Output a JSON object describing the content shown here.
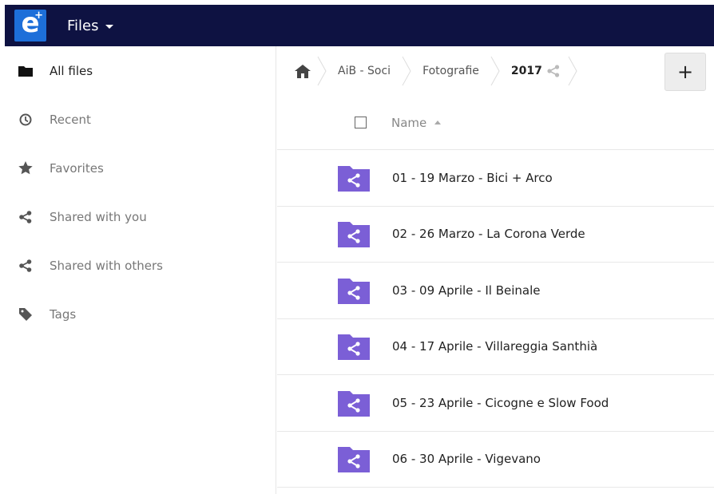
{
  "header": {
    "app_name": "Files"
  },
  "sidebar": {
    "items": [
      {
        "label": "All files",
        "icon": "folder-icon",
        "active": true
      },
      {
        "label": "Recent",
        "icon": "clock-icon",
        "active": false
      },
      {
        "label": "Favorites",
        "icon": "star-icon",
        "active": false
      },
      {
        "label": "Shared with you",
        "icon": "share-icon",
        "active": false
      },
      {
        "label": "Shared with others",
        "icon": "share-icon",
        "active": false
      },
      {
        "label": "Tags",
        "icon": "tag-icon",
        "active": false
      }
    ]
  },
  "breadcrumb": {
    "home_icon": "home-icon",
    "items": [
      "AiB - Soci",
      "Fotografie",
      "2017"
    ]
  },
  "file_list": {
    "column_name": "Name",
    "rows": [
      {
        "name": "01 - 19 Marzo - Bici + Arco",
        "icon": "shared-folder-icon"
      },
      {
        "name": "02 - 26 Marzo - La Corona Verde",
        "icon": "shared-folder-icon"
      },
      {
        "name": "03 - 09 Aprile - Il Beinale",
        "icon": "shared-folder-icon"
      },
      {
        "name": "04 - 17 Aprile - Villareggia Santhià",
        "icon": "shared-folder-icon"
      },
      {
        "name": "05 - 23 Aprile - Cicogne e Slow Food",
        "icon": "shared-folder-icon"
      },
      {
        "name": "06 - 30 Aprile - Vigevano",
        "icon": "shared-folder-icon"
      }
    ]
  },
  "colors": {
    "header_bg": "#0e1242",
    "logo_bg": "#1d6fd9",
    "folder": "#7b5fd6"
  }
}
